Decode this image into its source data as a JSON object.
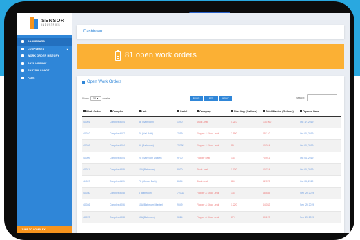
{
  "brand": {
    "name": "SENSOR",
    "sub": "INDUSTRIES"
  },
  "sidebar": {
    "items": [
      {
        "label": "DASHBOARD",
        "active": true
      },
      {
        "label": "COMPLEXES",
        "caret": "▾"
      },
      {
        "label": "WORK ORDER HISTORY"
      },
      {
        "label": "DATA LOOKUP"
      },
      {
        "label": "CUSTOM CHART"
      },
      {
        "label": "FAQS"
      }
    ],
    "footer": "JUMP TO COMPLEX"
  },
  "breadcrumb": {
    "title": "Dashboard"
  },
  "banner": {
    "text": "81 open work orders"
  },
  "panel": {
    "title": "Open Work Orders",
    "show_label": "Show",
    "show_value": "10 ▾",
    "show_suffix": "entries",
    "buttons": [
      "EXCEL",
      "PDF",
      "PRINT"
    ],
    "search_label": "Search:"
  },
  "table": {
    "headers": [
      "Work Order",
      "Complex",
      "Unit",
      "Serial",
      "Category",
      "First Day (Gallons)",
      "Total Wasted (Gallons)",
      "Opened Date"
    ],
    "rows": [
      [
        "40001",
        "Complex #004",
        "3B (Bathroom)",
        "1090",
        "Stuck Leak",
        "0.210",
        "133.960",
        "Oct 17, 2019"
      ],
      [
        "40010",
        "Complex #107",
        "7A (Hall Bath)",
        "7019",
        "Flapper & Stuck Leak",
        "2.590",
        "457.10",
        "Oct 01, 2019"
      ],
      [
        "40046",
        "Complex #004",
        "9A (Bathroom)",
        "7079F",
        "Flapper & Stuck Leak",
        "991",
        "60.044",
        "Oct 01, 2019"
      ],
      [
        "40009",
        "Complex #004",
        "2C (Bathroom Master)",
        "9730",
        "Flapper Leak",
        "134",
        "70.911",
        "Oct 01, 2019"
      ],
      [
        "40011",
        "Complex #409",
        "10A (Bathroom)",
        "8000",
        "Stuck Leak",
        "1.030",
        "60.744",
        "Oct 01, 2019"
      ],
      [
        "44007",
        "Complex #101",
        "7C (Master Bath)",
        "8604",
        "Stuck Leak",
        "885",
        "32.073",
        "Oct 05, 2019"
      ],
      [
        "40030",
        "Complex #008",
        "6 (Bathroom)",
        "7230A",
        "Flapper & Stuck Leak",
        "334",
        "48.535",
        "Sep 29, 2019"
      ],
      [
        "40046",
        "Complex #006",
        "10A (Bathroom Master)",
        "9049",
        "Flapper & Stuck Leak",
        "1.220",
        "44.032",
        "Sep 29, 2019"
      ],
      [
        "40070",
        "Complex #008",
        "10A (Bathroom)",
        "3024",
        "Flapper & Stuck Leak",
        "879",
        "40.170",
        "Sep 29, 2019"
      ]
    ]
  },
  "colors": {
    "accent": "#2f86d8",
    "banner": "#fbb034",
    "footer": "#f7941d",
    "link": "#6b9be0",
    "alert": "#ee7b7b"
  }
}
